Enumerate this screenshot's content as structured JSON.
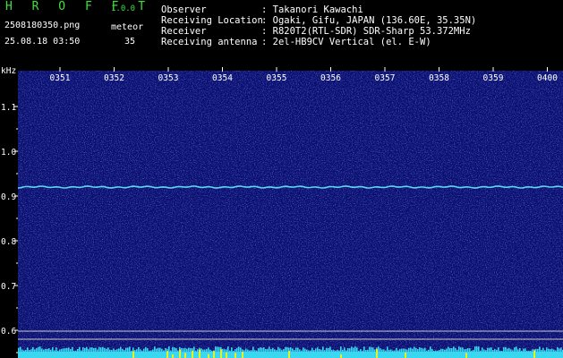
{
  "header": {
    "app_name": "H R O F F T",
    "app_version": "1.0.0",
    "filename": "2508180350.png",
    "timestamp": "25.08.18 03:50",
    "meteor_label": "meteor",
    "meteor_count": "35",
    "info": [
      {
        "label": "Observer",
        "value": ": Takanori Kawachi"
      },
      {
        "label": "Receiving Location",
        "value": ": Ogaki, Gifu, JAPAN (136.60E, 35.35N)"
      },
      {
        "label": "Receiver",
        "value": ": R820T2(RTL-SDR) SDR-Sharp 53.372MHz"
      },
      {
        "label": "Receiving antenna",
        "value": ": 2el-HB9CV Vertical (el. E-W)"
      }
    ]
  },
  "spectrogram": {
    "y_unit": "kHz",
    "y_ticks": [
      "1.1",
      "1.0",
      "0.9",
      "0.8",
      "0.7",
      "0.6"
    ],
    "x_ticks": [
      "0351",
      "0352",
      "0353",
      "0354",
      "0355",
      "0356",
      "0357",
      "0358",
      "0359",
      "0400"
    ],
    "carrier_khz": 0.92,
    "colors": {
      "background": "#0a0f6e",
      "noise": "#2a3cc8",
      "carrier": "#5ad7f0",
      "bottom_band": "#3ad8f0",
      "bottom_peaks": "#e8f020",
      "ref_lines": "#c8c8c8"
    }
  }
}
